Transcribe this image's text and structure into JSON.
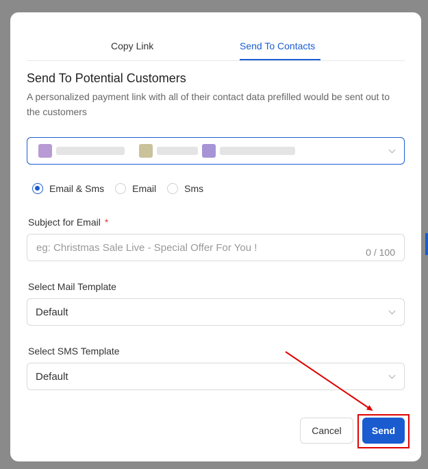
{
  "tabs": [
    {
      "label": "Copy Link",
      "active": false
    },
    {
      "label": "Send To Contacts",
      "active": true
    }
  ],
  "section": {
    "title": "Send To Potential Customers",
    "description": "A personalized payment link with all of their contact data prefilled would be sent out to the customers"
  },
  "contacts": {
    "chips": [
      "blurred-contact-1",
      "blurred-contact-2",
      "blurred-contact-3"
    ]
  },
  "channels": {
    "options": [
      "Email & Sms",
      "Email",
      "Sms"
    ],
    "selected": "Email & Sms"
  },
  "subject": {
    "label": "Subject for Email",
    "required_mark": "*",
    "placeholder": "eg: Christmas Sale Live - Special Offer For You !",
    "value": "",
    "counter": "0 / 100"
  },
  "mail_template": {
    "label": "Select Mail Template",
    "value": "Default"
  },
  "sms_template": {
    "label": "Select SMS Template",
    "value": "Default"
  },
  "actions": {
    "cancel_label": "Cancel",
    "send_label": "Send"
  },
  "colors": {
    "accent": "#1a5cd0",
    "annotation": "#e00000"
  }
}
